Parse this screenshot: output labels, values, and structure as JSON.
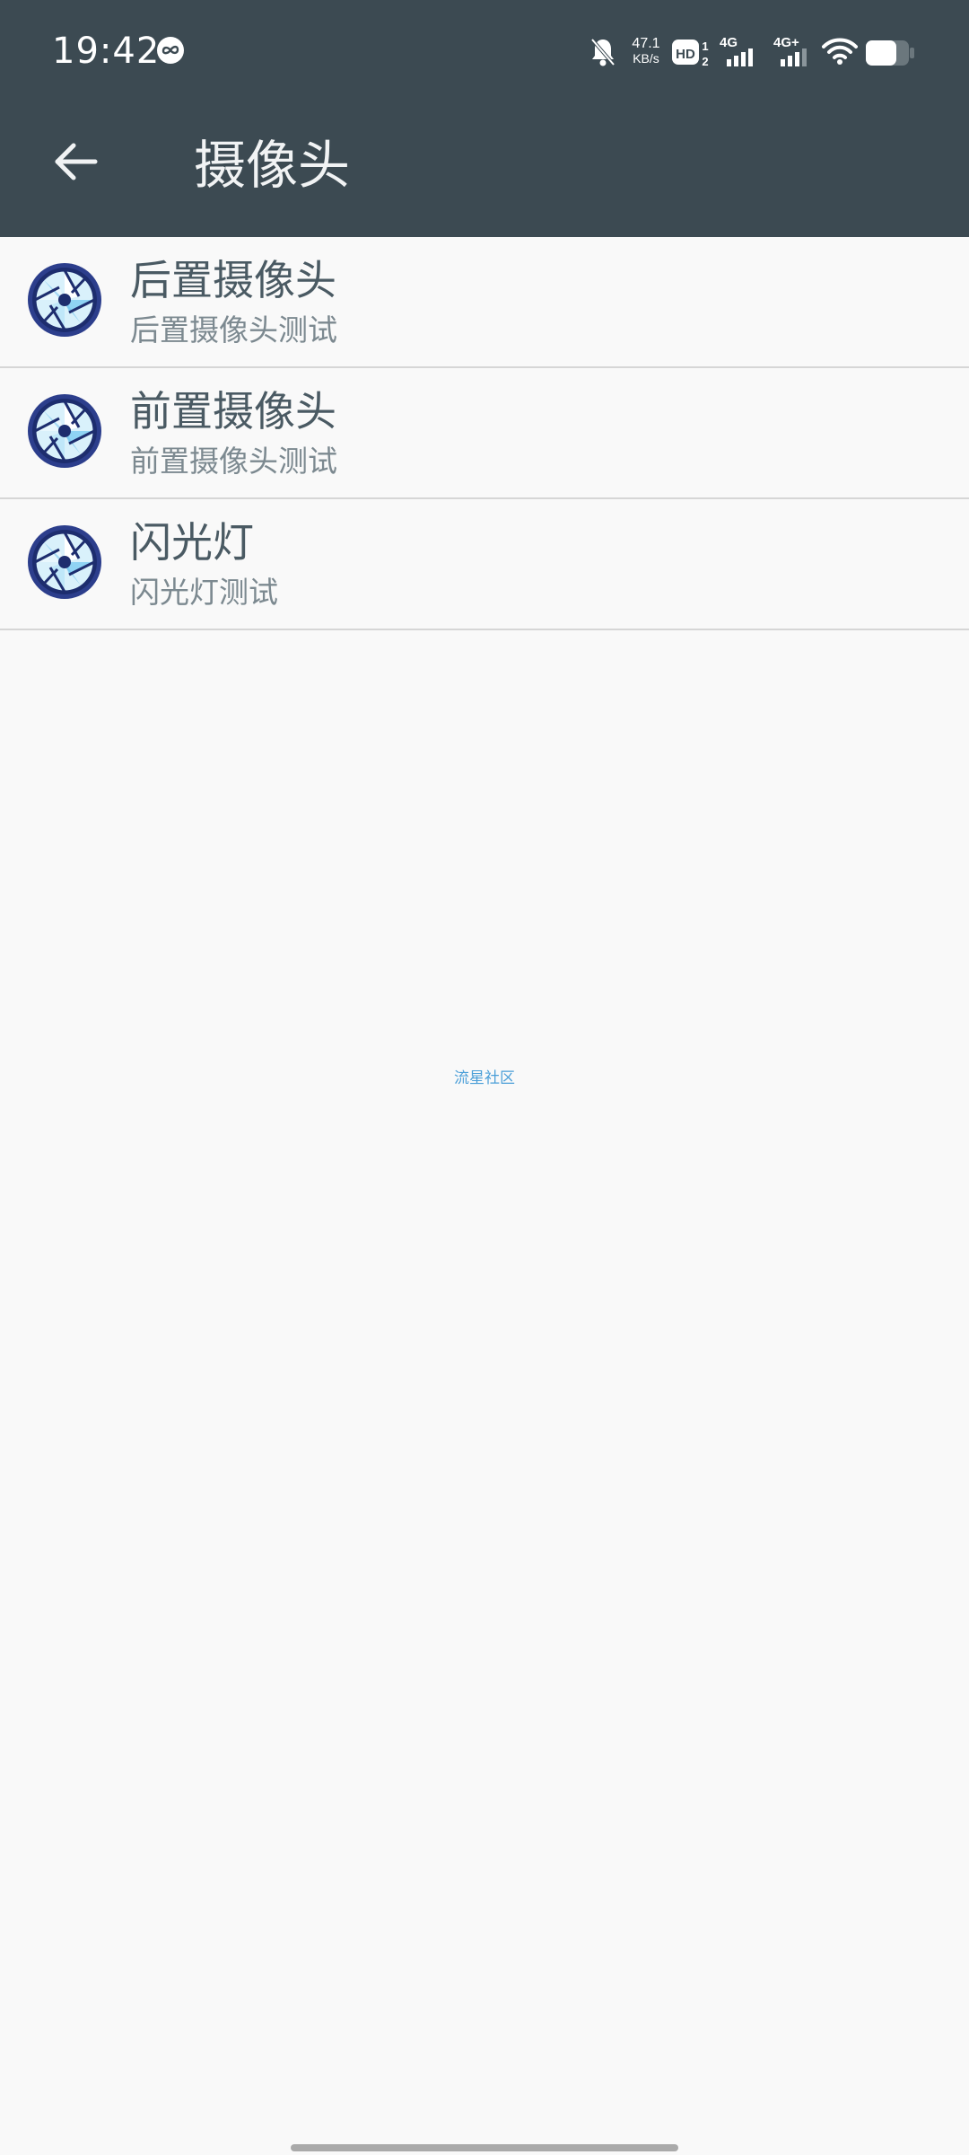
{
  "status_bar": {
    "time": "19:42",
    "net_speed_value": "47.1",
    "net_speed_unit": "KB/s",
    "hd_label": "HD",
    "sim1_label": "4G",
    "sim2_label": "4G+"
  },
  "toolbar": {
    "title": "摄像头",
    "back_icon": "arrow-left-icon"
  },
  "list": {
    "items": [
      {
        "title": "后置摄像头",
        "subtitle": "后置摄像头测试",
        "icon": "camera-aperture-icon"
      },
      {
        "title": "前置摄像头",
        "subtitle": "前置摄像头测试",
        "icon": "camera-aperture-icon"
      },
      {
        "title": "闪光灯",
        "subtitle": "闪光灯测试",
        "icon": "camera-aperture-icon"
      }
    ]
  },
  "watermark": "流星社区",
  "colors": {
    "header": "#3c4a52",
    "background": "#f9f9f9",
    "title_text": "#4a5a63",
    "subtitle_text": "#7c8990",
    "watermark": "#4b9fd8"
  }
}
